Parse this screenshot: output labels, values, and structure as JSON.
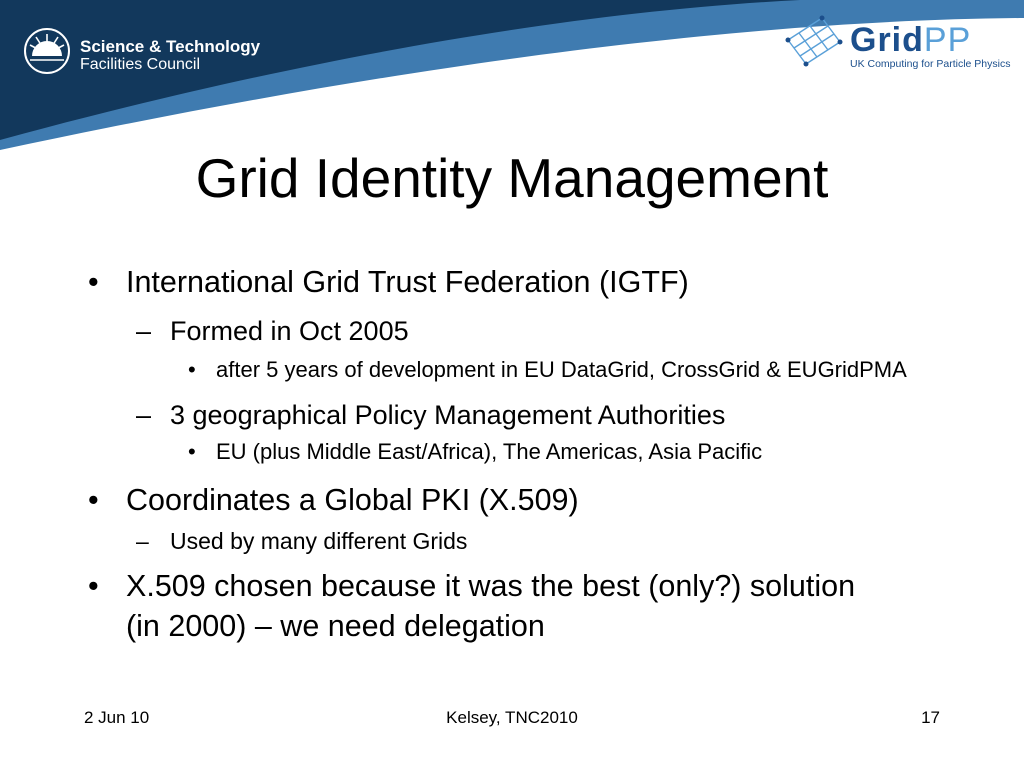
{
  "header": {
    "stfc": {
      "line1": "Science & Technology",
      "line2": "Facilities Council"
    },
    "gridpp": {
      "word_main": "Grid",
      "word_accent": "PP",
      "tagline": "UK Computing for Particle Physics"
    },
    "colors": {
      "band": "#12385c",
      "band_accent": "#3f7bb0",
      "gridpp_dark": "#1c4f8c",
      "gridpp_light": "#5aa0d8"
    }
  },
  "slide": {
    "title": "Grid Identity Management",
    "bullets": [
      {
        "text": "International Grid Trust Federation (IGTF)",
        "children": [
          {
            "text": "Formed in Oct 2005",
            "children": [
              "after 5 years of development in EU DataGrid, CrossGrid & EUGridPMA"
            ]
          },
          {
            "text": "3 geographical Policy Management Authorities",
            "children": [
              "EU (plus Middle East/Africa), The Americas, Asia Pacific"
            ]
          }
        ]
      },
      {
        "text": "Coordinates a Global PKI (X.509)",
        "children": [
          {
            "text": "Used by many different Grids",
            "children": []
          }
        ]
      },
      {
        "text": "X.509 chosen because it was the best (only?) solution (in 2000) – we need delegation",
        "children": []
      }
    ]
  },
  "markers": {
    "bullet": "•",
    "dash": "–"
  },
  "footer": {
    "date": "2 Jun 10",
    "center": "Kelsey, TNC2010",
    "page": "17"
  }
}
